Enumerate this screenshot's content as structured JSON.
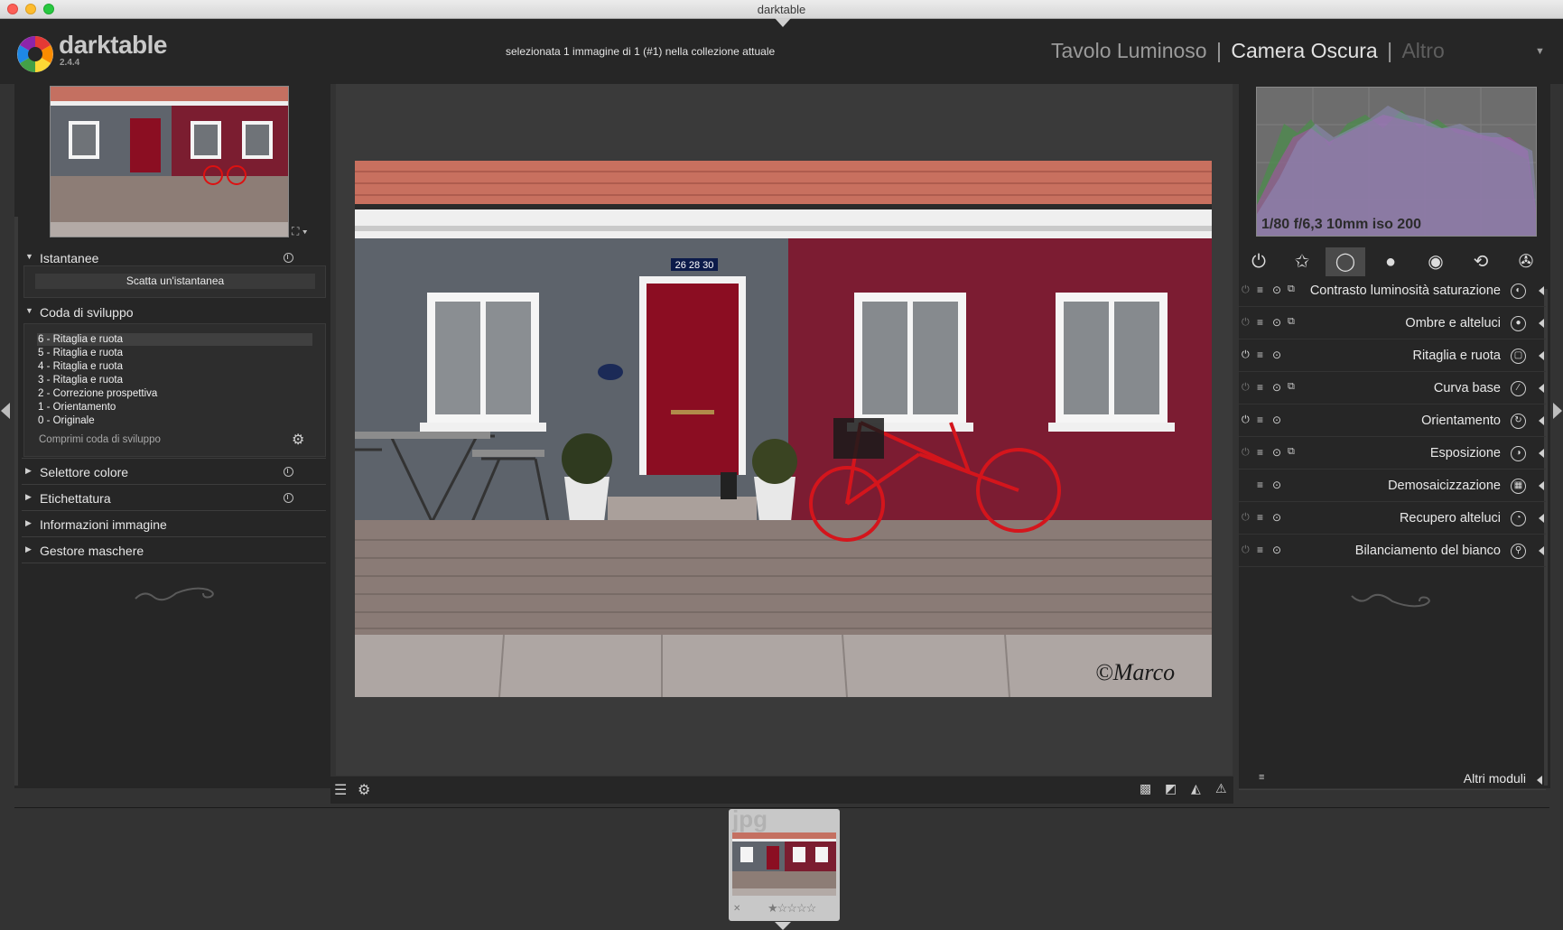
{
  "window": {
    "title": "darktable"
  },
  "app": {
    "name": "darktable",
    "version": "2.4.4"
  },
  "header": {
    "selection_info": "selezionata 1 immagine di 1 (#1) nella collezione attuale",
    "views": {
      "lighttable": "Tavolo Luminoso",
      "separator": "|",
      "darkroom": "Camera Oscura",
      "other": "Altro"
    },
    "dropdown_icon": "triangle-down-icon"
  },
  "left_panel": {
    "snapshots": {
      "title": "Istantanee",
      "take_button": "Scatta un'istantanea"
    },
    "history": {
      "title": "Coda di sviluppo",
      "items": [
        "6 - Ritaglia e ruota",
        "5 - Ritaglia e ruota",
        "4 - Ritaglia e ruota",
        "3 - Ritaglia e ruota",
        "2 - Correzione prospettiva",
        "1 - Orientamento",
        "0 - Originale"
      ],
      "active_index": 0,
      "compress_button": "Comprimi coda di sviluppo"
    },
    "sections": {
      "color_picker": "Selettore colore",
      "tagging": "Etichettatura",
      "image_info": "Informazioni immagine",
      "mask_manager": "Gestore maschere"
    }
  },
  "histogram": {
    "exif": "1/80 f/6,3 10mm iso 200"
  },
  "module_groups": [
    {
      "name": "power-icon",
      "glyph": "⏻"
    },
    {
      "name": "star-icon",
      "glyph": "✩"
    },
    {
      "name": "circle-icon",
      "glyph": "◯"
    },
    {
      "name": "sphere-icon",
      "glyph": "●"
    },
    {
      "name": "color-ball-icon",
      "glyph": "◉"
    },
    {
      "name": "refresh-icon",
      "glyph": "⟲"
    },
    {
      "name": "film-reel-icon",
      "glyph": "✇"
    }
  ],
  "modules": [
    {
      "name": "Contrasto luminosità saturazione",
      "enabled": false,
      "icon": "◐"
    },
    {
      "name": "Ombre e alteluci",
      "enabled": false,
      "icon": "●"
    },
    {
      "name": "Ritaglia e ruota",
      "enabled": true,
      "icon": "▢"
    },
    {
      "name": "Curva base",
      "enabled": false,
      "icon": "∕"
    },
    {
      "name": "Orientamento",
      "enabled": true,
      "icon": "↻"
    },
    {
      "name": "Esposizione",
      "enabled": false,
      "icon": "◑"
    },
    {
      "name": "Demosaicizzazione",
      "enabled": true,
      "icon": "▦"
    },
    {
      "name": "Recupero alteluci",
      "enabled": false,
      "icon": "◔"
    },
    {
      "name": "Bilanciamento del bianco",
      "enabled": false,
      "icon": "⚲"
    }
  ],
  "more_modules": "Altri moduli",
  "photo": {
    "watermark": "©Marco",
    "house_number": "26 28 30"
  },
  "filmstrip": {
    "extension": "jpg",
    "reject": "✕",
    "stars": "★☆☆☆☆"
  }
}
